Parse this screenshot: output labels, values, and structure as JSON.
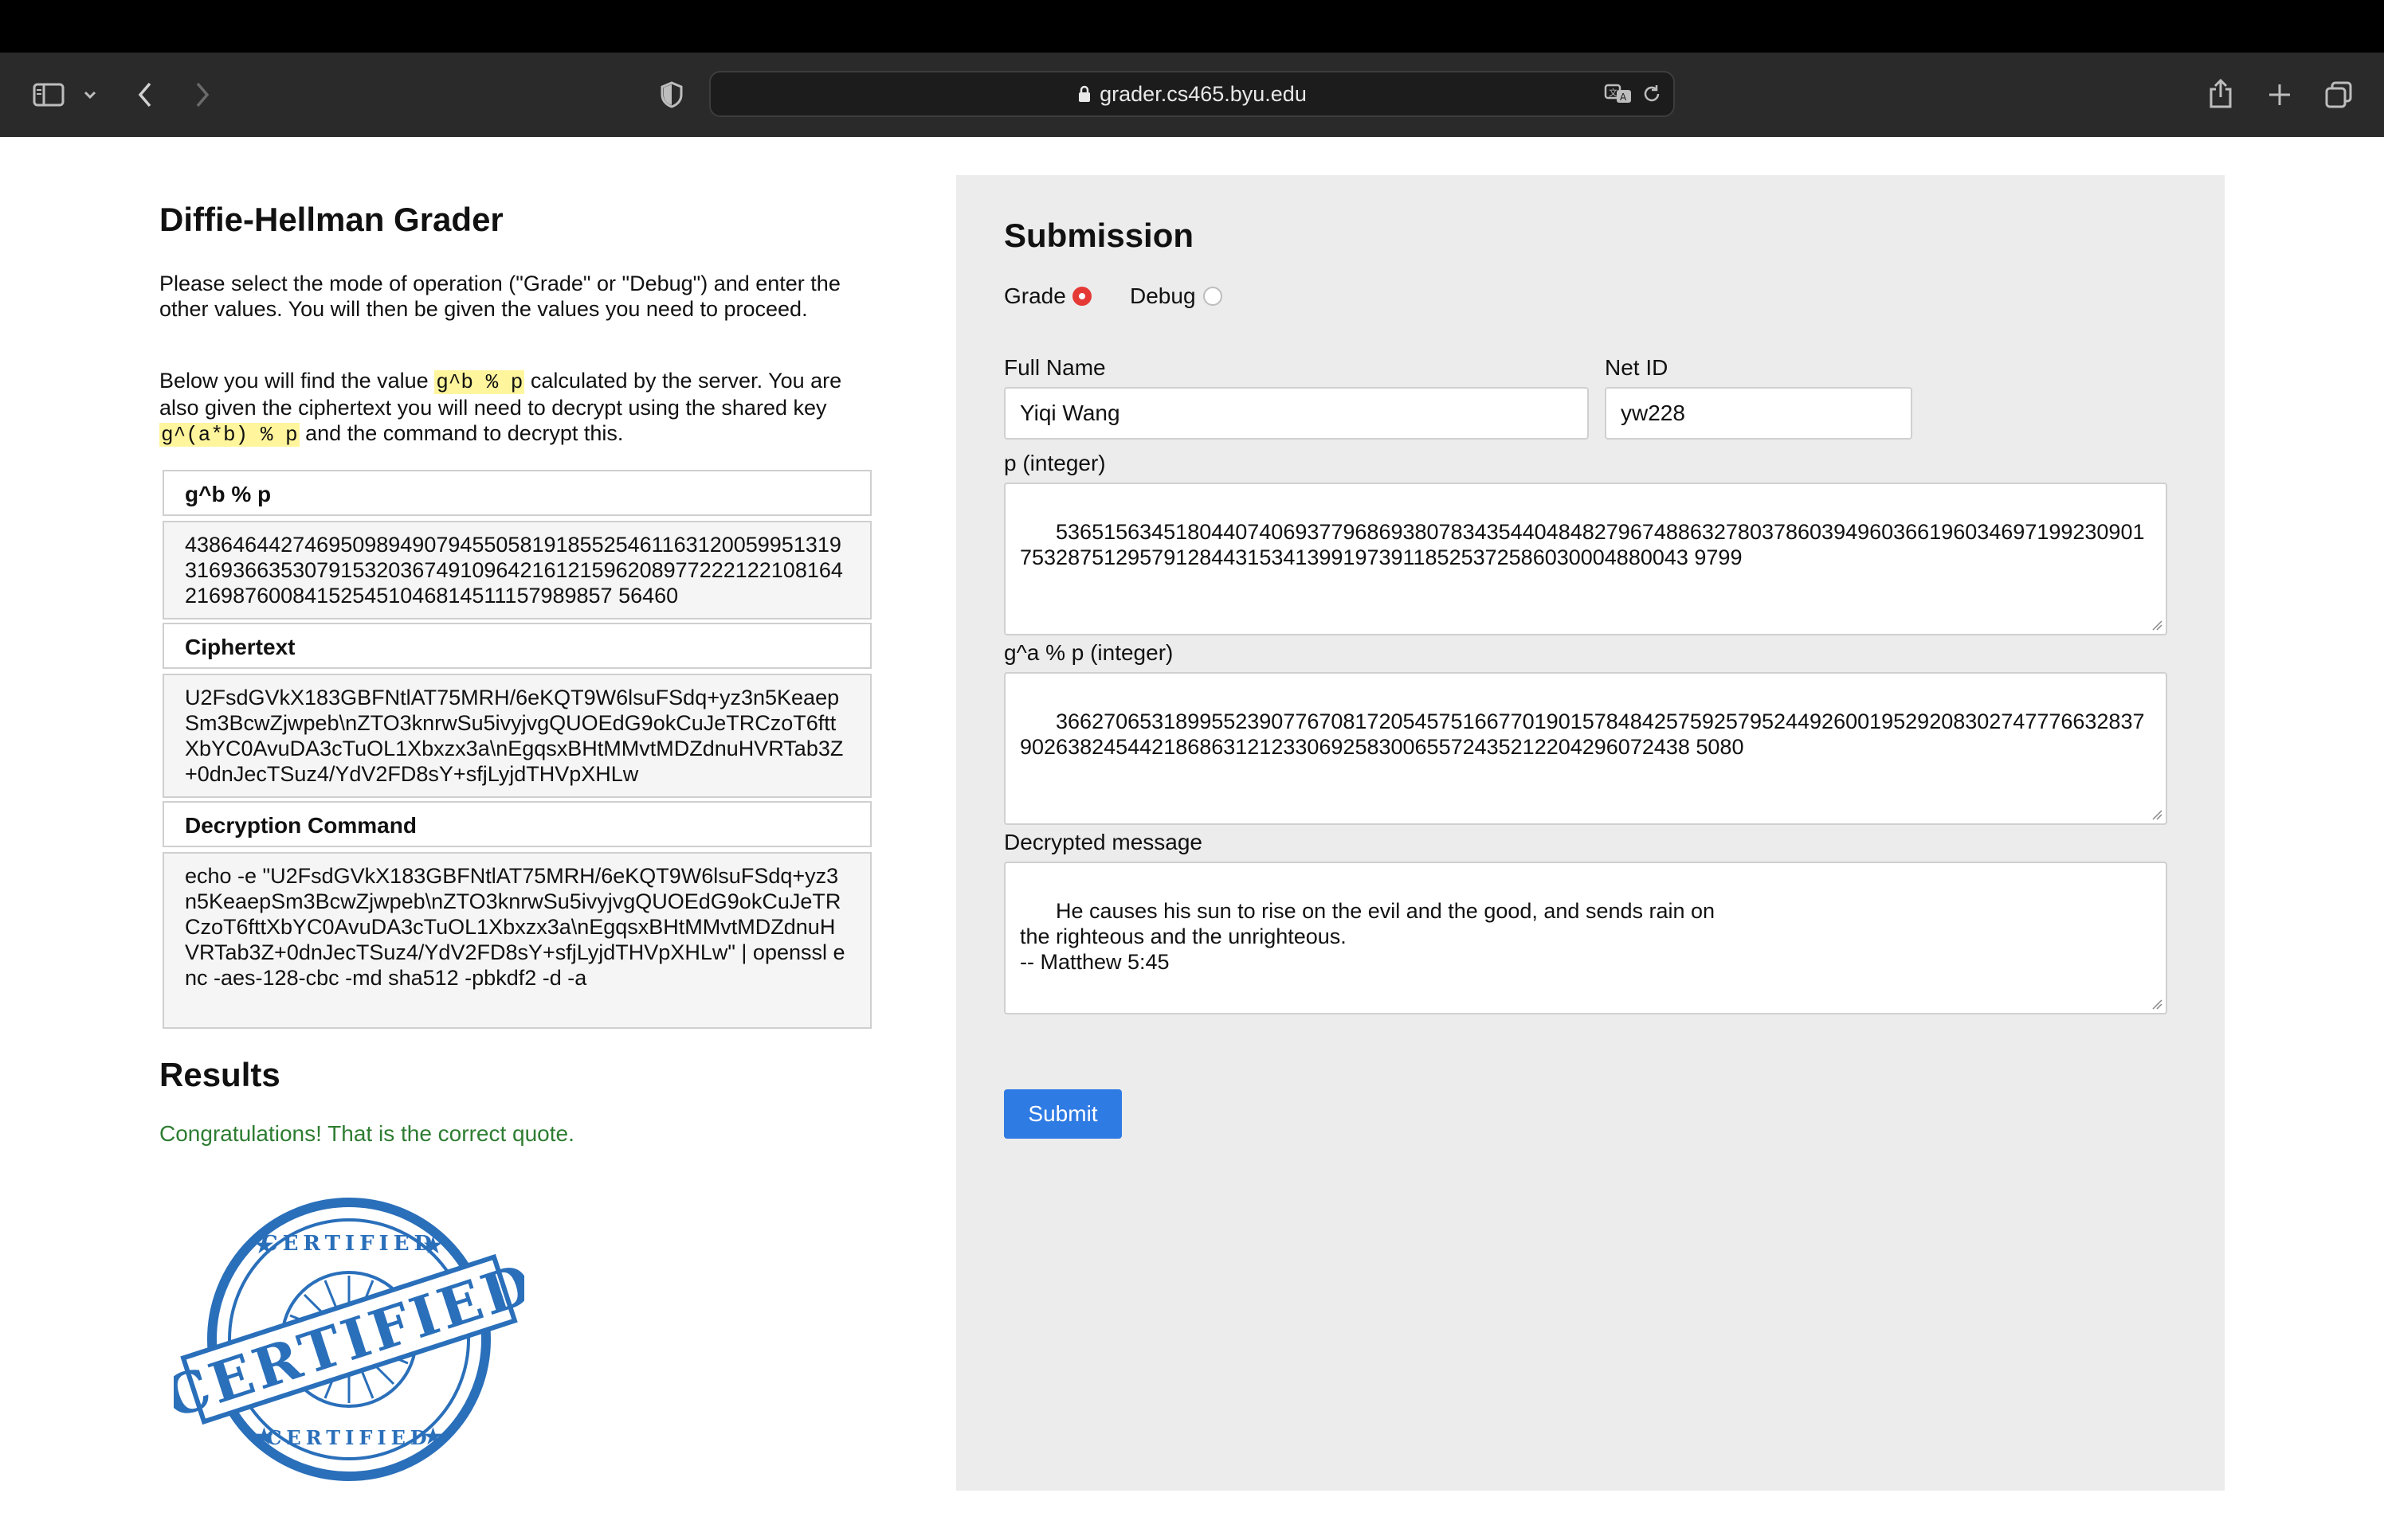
{
  "browser": {
    "url": "grader.cs465.byu.edu"
  },
  "left": {
    "title": "Diffie-Hellman Grader",
    "intro": "Please select the mode of operation (\"Grade\" or \"Debug\") and enter the other values. You will then be given the values you need to proceed.",
    "below_pre": "Below you will find the value ",
    "below_code1": "g^b % p",
    "below_mid": " calculated by the server. You are also given the ciphertext you will need to decrypt using the shared key ",
    "below_code2": "g^(a*b) % p",
    "below_post": " and the command to decrypt this.",
    "gbp_label": "g^b % p",
    "gbp_value": "43864644274695098949079455058191855254611631200599513193169366353079153203674910964216121596208977222122108164216987600841525451046814511157989857 56460",
    "cipher_label": "Ciphertext",
    "cipher_value": "U2FsdGVkX183GBFNtlAT75MRH/6eKQT9W6lsuFSdq+yz3n5KeaepSm3BcwZjwpeb\\nZTO3knrwSu5ivyjvgQUOEdG9okCuJeTRCzoT6fttXbYC0AvuDA3cTuOL1Xbxzx3a\\nEgqsxBHtMMvtMDZdnuHVRTab3Z+0dnJecTSuz4/YdV2FD8sY+sfjLyjdTHVpXHLw",
    "cmd_label": "Decryption Command",
    "cmd_value": "echo -e \"U2FsdGVkX183GBFNtlAT75MRH/6eKQT9W6lsuFSdq+yz3n5KeaepSm3BcwZjwpeb\\nZTO3knrwSu5ivyjvgQUOEdG9okCuJeTRCzoT6fttXbYC0AvuDA3cTuOL1Xbxzx3a\\nEgqsxBHtMMvtMDZdnuHVRTab3Z+0dnJecTSuz4/YdV2FD8sY+sfjLyjdTHVpXHLw\" | openssl enc -aes-128-cbc -md sha512 -pbkdf2 -d -a",
    "results_title": "Results",
    "results_message": "Congratulations! That is the correct quote.",
    "stamp_top": "CERTIFIED",
    "stamp_main": "CERTIFIED",
    "stamp_bottom": "CERTIFIED"
  },
  "submission": {
    "title": "Submission",
    "mode_grade": "Grade",
    "mode_debug": "Debug",
    "selected_mode": "Grade",
    "full_name_label": "Full Name",
    "full_name_value": "Yiqi Wang",
    "net_id_label": "Net ID",
    "net_id_value": "yw228",
    "p_label": "p (integer)",
    "p_value": "536515634518044074069377968693807834354404848279674886327803786039496036619603469719923090175328751295791284431534139919739118525372586030004880043 9799",
    "ga_label": "g^a % p (integer)",
    "ga_value": "366270653189955239077670817205457516677019015784842575925795244926001952920830274777663283790263824544218686312123306925830065572435212204296072438 5080",
    "msg_label": "Decrypted message",
    "msg_value": "He causes his sun to rise on the evil and the good, and sends rain on\nthe righteous and the unrighteous.\n-- Matthew 5:45",
    "submit_label": "Submit"
  },
  "colors": {
    "accent": "#2f7be4",
    "radio_selected": "#e53935",
    "success": "#2e7d32",
    "highlight": "#fff59d",
    "stamp": "#2a6fba"
  }
}
